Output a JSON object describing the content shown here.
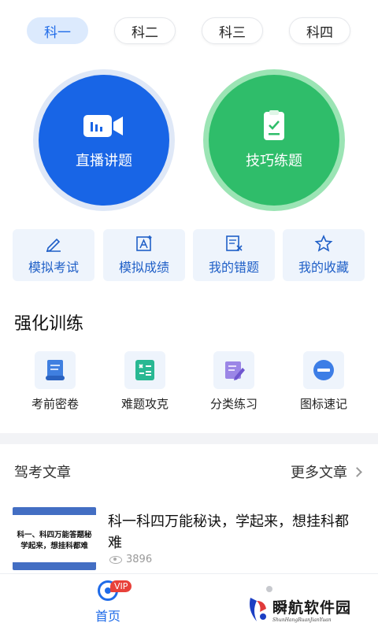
{
  "subject_tabs": [
    "科一",
    "科二",
    "科三",
    "科四"
  ],
  "big_buttons": {
    "live": "直播讲题",
    "practice": "技巧练题"
  },
  "cards": [
    "模拟考试",
    "模拟成绩",
    "我的错题",
    "我的收藏"
  ],
  "section_title": "强化训练",
  "training": [
    "考前密卷",
    "难题攻克",
    "分类练习",
    "图标速记"
  ],
  "articles_header": {
    "title": "驾考文章",
    "more": "更多文章"
  },
  "article": {
    "thumb_line1": "科一、科四万能答题秘",
    "thumb_line2": "学起来，想挂科都难",
    "title": "科一科四万能秘诀，学起来，想挂科都难",
    "views": "3896"
  },
  "bottom_nav": {
    "home": "首页",
    "vip_badge": "VIP"
  },
  "watermark": {
    "cn": "瞬航软件园",
    "en": "ShunHangRuanJianYuan"
  },
  "colors": {
    "accent_blue": "#1865e6",
    "accent_green": "#2fbd6a",
    "active_tab_bg": "#dceafd",
    "vip_red": "#e8413a"
  }
}
